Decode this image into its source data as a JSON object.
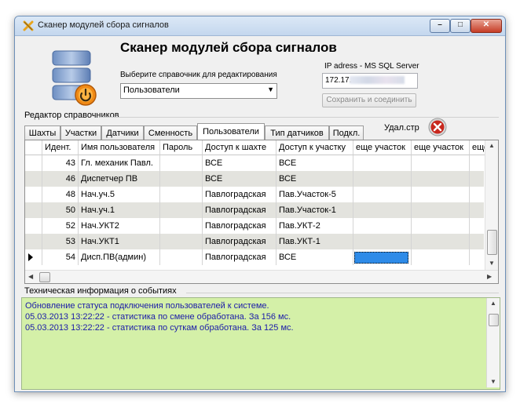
{
  "window": {
    "title": "Сканер модулей сбора сигналов",
    "min_label": "–",
    "max_label": "□",
    "close_label": "✕"
  },
  "header": {
    "app_title": "Сканер модулей сбора сигналов",
    "select_label": "Выберите справочник для редактирования",
    "select_value": "Пользователи",
    "ip_label": "IP adress - MS SQL Server",
    "ip_value": "172.17.",
    "save_button": "Сохранить и соединить"
  },
  "editor": {
    "label": "Редактор справочников",
    "delete_label": "Удал.стр",
    "tabs": [
      "Шахты",
      "Участки",
      "Датчики",
      "Сменность",
      "Пользователи",
      "Тип датчиков",
      "Подкл."
    ],
    "active_tab": "Пользователи"
  },
  "table": {
    "columns": [
      "Идент.",
      "Имя пользователя",
      "Пароль",
      "Доступ к шахте",
      "Доступ к участку",
      "еще участок",
      "еще участок",
      "еще у"
    ],
    "rows": [
      {
        "id": "43",
        "name": "Гл. механик Павл.",
        "password": "",
        "mine": "ВСЕ",
        "section": "ВСЕ"
      },
      {
        "id": "46",
        "name": "Диспетчер ПВ",
        "password": "",
        "mine": "ВСЕ",
        "section": "ВСЕ"
      },
      {
        "id": "48",
        "name": "Нач.уч.5",
        "password": "",
        "mine": "Павлоградская",
        "section": "Пав.Участок-5"
      },
      {
        "id": "50",
        "name": "Нач.уч.1",
        "password": "",
        "mine": "Павлоградская",
        "section": "Пав.Участок-1"
      },
      {
        "id": "52",
        "name": "Нач.УКТ2",
        "password": "",
        "mine": "Павлоградская",
        "section": "Пав.УКТ-2"
      },
      {
        "id": "53",
        "name": "Нач.УКТ1",
        "password": "",
        "mine": "Павлоградская",
        "section": "Пав.УКТ-1"
      },
      {
        "id": "54",
        "name": "Дисп.ПВ(админ)",
        "password": "",
        "mine": "Павлоградская",
        "section": "ВСЕ"
      }
    ]
  },
  "tech": {
    "label": "Техническая информация о событиях",
    "lines": [
      " Обновление статуса подключения пользователей к системе.",
      "05.03.2013 13:22:22 - статистика по смене обработана. За 156 мс.",
      "05.03.2013 13:22:22 - статистика по суткам обработана. За 125 мс."
    ]
  },
  "colors": {
    "log_background": "#d4f0a8",
    "log_text": "#1a1aa8",
    "selected_cell": "#2e8be8",
    "alt_row": "#e3e3de"
  }
}
